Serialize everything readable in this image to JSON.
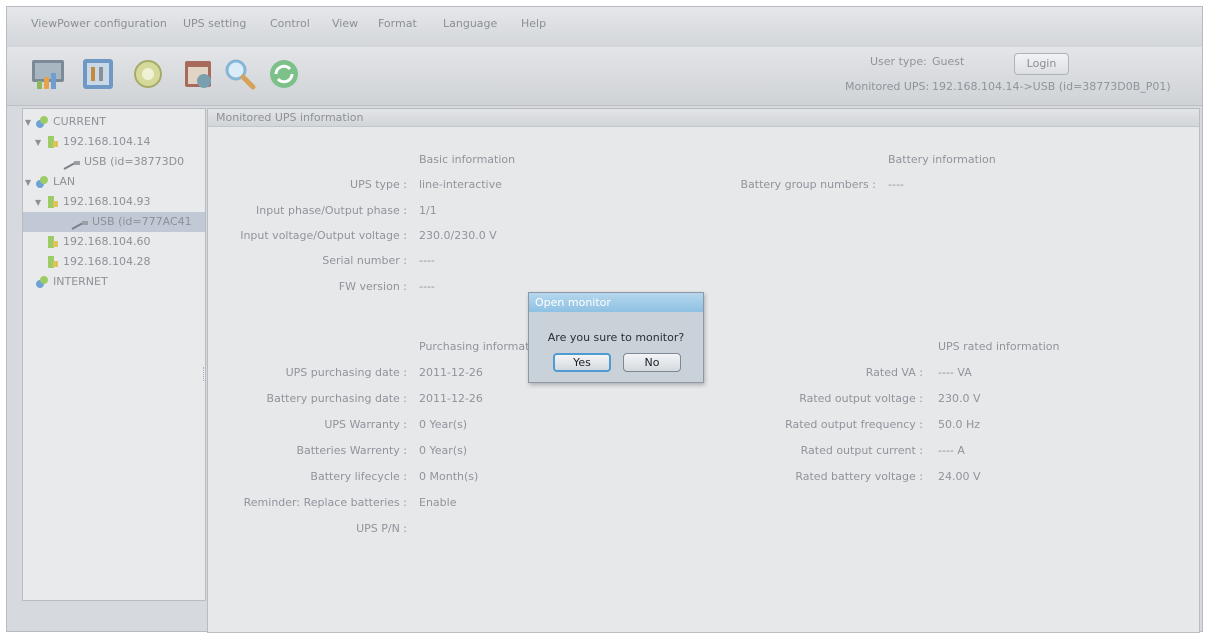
{
  "menubar": {
    "items": [
      "ViewPower configuration",
      "UPS setting",
      "Control",
      "View",
      "Format",
      "Language",
      "Help"
    ]
  },
  "toolbar": {
    "icons": [
      "monitor-icon",
      "ups-settings-icon",
      "control-icon",
      "schedule-icon",
      "search-icon",
      "refresh-icon"
    ],
    "user_type_label": "User type:",
    "user_type_value": "Guest",
    "login_label": "Login",
    "monitored_label": "Monitored UPS:",
    "monitored_value": "192.168.104.14->USB (id=38773D0B_P01)"
  },
  "tree": {
    "nodes": [
      {
        "label": "CURRENT"
      },
      {
        "label": "192.168.104.14"
      },
      {
        "label": "USB (id=38773D0"
      },
      {
        "label": "LAN"
      },
      {
        "label": "192.168.104.93"
      },
      {
        "label": "USB (id=777AC41"
      },
      {
        "label": "192.168.104.60"
      },
      {
        "label": "192.168.104.28"
      },
      {
        "label": "INTERNET"
      }
    ]
  },
  "main": {
    "title": "Monitored UPS information",
    "basic": {
      "heading": "Basic information",
      "rows": [
        {
          "label": "UPS type :",
          "value": "line-interactive"
        },
        {
          "label": "Input phase/Output phase :",
          "value": "1/1"
        },
        {
          "label": "Input voltage/Output voltage :",
          "value": "230.0/230.0 V"
        },
        {
          "label": "Serial number :",
          "value": "----"
        },
        {
          "label": "FW version :",
          "value": "----"
        }
      ]
    },
    "battery": {
      "heading": "Battery information",
      "rows": [
        {
          "label": "Battery group numbers :",
          "value": "----"
        }
      ]
    },
    "purchasing": {
      "heading": "Purchasing informatio",
      "rows": [
        {
          "label": "UPS purchasing date :",
          "value": "2011-12-26"
        },
        {
          "label": "Battery purchasing date :",
          "value": "2011-12-26"
        },
        {
          "label": "UPS Warranty :",
          "value": "0 Year(s)"
        },
        {
          "label": "Batteries Warrenty :",
          "value": "0 Year(s)"
        },
        {
          "label": "Battery lifecycle :",
          "value": "0 Month(s)"
        },
        {
          "label": "Reminder: Replace batteries :",
          "value": "Enable"
        },
        {
          "label": "UPS P/N :",
          "value": ""
        }
      ]
    },
    "rated": {
      "heading": "UPS rated information",
      "rows": [
        {
          "label": "Rated VA :",
          "value": "---- VA"
        },
        {
          "label": "Rated output voltage :",
          "value": "230.0 V"
        },
        {
          "label": "Rated output frequency :",
          "value": "50.0 Hz"
        },
        {
          "label": "Rated output current :",
          "value": "---- A"
        },
        {
          "label": "Rated battery voltage :",
          "value": "24.00 V"
        }
      ]
    }
  },
  "dialog": {
    "title": "Open monitor",
    "message": "Are you sure to monitor?",
    "yes_label": "Yes",
    "no_label": "No"
  }
}
